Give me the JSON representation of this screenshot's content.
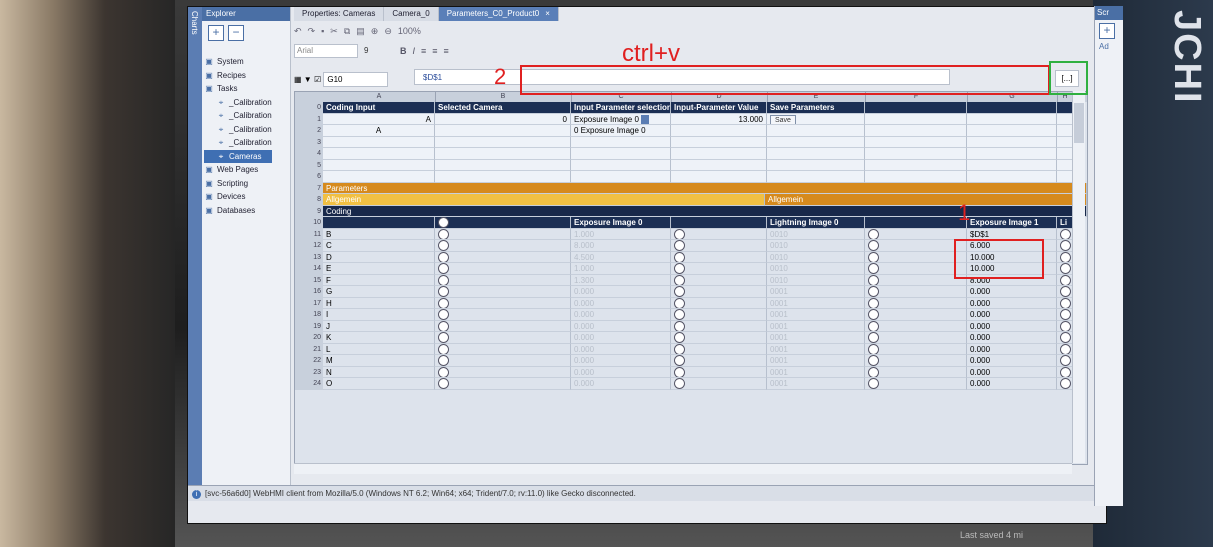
{
  "explorer": {
    "title": "Explorer",
    "charts_label": "Charts",
    "tree": [
      {
        "label": "System",
        "child": false,
        "selected": false
      },
      {
        "label": "Recipes",
        "child": false,
        "selected": false
      },
      {
        "label": "Tasks",
        "child": false,
        "selected": false
      },
      {
        "label": "_Calibration",
        "child": true,
        "selected": false
      },
      {
        "label": "_Calibration",
        "child": true,
        "selected": false
      },
      {
        "label": "_Calibration",
        "child": true,
        "selected": false
      },
      {
        "label": "_Calibration",
        "child": true,
        "selected": false
      },
      {
        "label": "Cameras",
        "child": true,
        "selected": true
      },
      {
        "label": "Web Pages",
        "child": false,
        "selected": false
      },
      {
        "label": "Scripting",
        "child": false,
        "selected": false
      },
      {
        "label": "Devices",
        "child": false,
        "selected": false
      },
      {
        "label": "Databases",
        "child": false,
        "selected": false
      }
    ]
  },
  "tabs": [
    {
      "label": "Properties: Cameras",
      "active": false
    },
    {
      "label": "Camera_0",
      "active": false
    },
    {
      "label": "Parameters_C0_Product0",
      "active": true
    }
  ],
  "toolbar": {
    "font_name": "Arial",
    "font_size": "9",
    "zoom": "100%",
    "bold": "B",
    "italic": "I"
  },
  "formula": {
    "name_box": "G10",
    "value": "$D$1",
    "expand": "[...]"
  },
  "columns": [
    "A",
    "B",
    "C",
    "D",
    "E",
    "F",
    "G",
    "H"
  ],
  "row0": {
    "rownum": "0",
    "a": "Coding Input",
    "b": "Selected Camera",
    "c": "Input Parameter selection",
    "d": "Input-Parameter Value",
    "e": "Save Parameters"
  },
  "row1": {
    "rownum": "1",
    "a": "A",
    "b": "0",
    "c": "Exposure Image 0",
    "d": "13.000",
    "e": "Save"
  },
  "row2": {
    "rownum": "2",
    "a": "A",
    "b": "",
    "c": "0 Exposure Image 0"
  },
  "sections": {
    "parameters": "Parameters",
    "allgemein": "Allgemein",
    "allgemein_right": "Allgemein",
    "coding": "Coding"
  },
  "sub_headers": {
    "exposure0": "Exposure Image 0",
    "lightning0": "Lightning Image 0",
    "exposure1": "Exposure Image 1",
    "extra": "Li"
  },
  "data_rows": [
    {
      "num": "11",
      "code": "B",
      "c": "1.000",
      "e": "0010",
      "g": "$D$1"
    },
    {
      "num": "12",
      "code": "C",
      "c": "8.000",
      "e": "0010",
      "g": "6.000"
    },
    {
      "num": "13",
      "code": "D",
      "c": "4.500",
      "e": "0010",
      "g": "10.000"
    },
    {
      "num": "14",
      "code": "E",
      "c": "1.000",
      "e": "0010",
      "g": "10.000"
    },
    {
      "num": "15",
      "code": "F",
      "c": "1.300",
      "e": "0010",
      "g": "8.000"
    },
    {
      "num": "16",
      "code": "G",
      "c": "0.000",
      "e": "0001",
      "g": "0.000"
    },
    {
      "num": "17",
      "code": "H",
      "c": "0.000",
      "e": "0001",
      "g": "0.000"
    },
    {
      "num": "18",
      "code": "I",
      "c": "0.000",
      "e": "0001",
      "g": "0.000"
    },
    {
      "num": "19",
      "code": "J",
      "c": "0.000",
      "e": "0001",
      "g": "0.000"
    },
    {
      "num": "20",
      "code": "K",
      "c": "0.000",
      "e": "0001",
      "g": "0.000"
    },
    {
      "num": "21",
      "code": "L",
      "c": "0.000",
      "e": "0001",
      "g": "0.000"
    },
    {
      "num": "22",
      "code": "M",
      "c": "0.000",
      "e": "0001",
      "g": "0.000"
    },
    {
      "num": "23",
      "code": "N",
      "c": "0.000",
      "e": "0001",
      "g": "0.000"
    },
    {
      "num": "24",
      "code": "O",
      "c": "0.000",
      "e": "0001",
      "g": "0.000"
    }
  ],
  "status": "[svc-56a6d0] WebHMI client from Mozilla/5.0 (Windows NT 6.2; Win64; x64; Trident/7.0; rv:11.0) like Gecko disconnected.",
  "right_panel": {
    "title": "Scr",
    "subtitle": "Ad"
  },
  "brand": "JCHI",
  "annotations": {
    "label1": "1",
    "label2": "2",
    "hint": "ctrl+v"
  },
  "footer": "Last saved 4 mi"
}
